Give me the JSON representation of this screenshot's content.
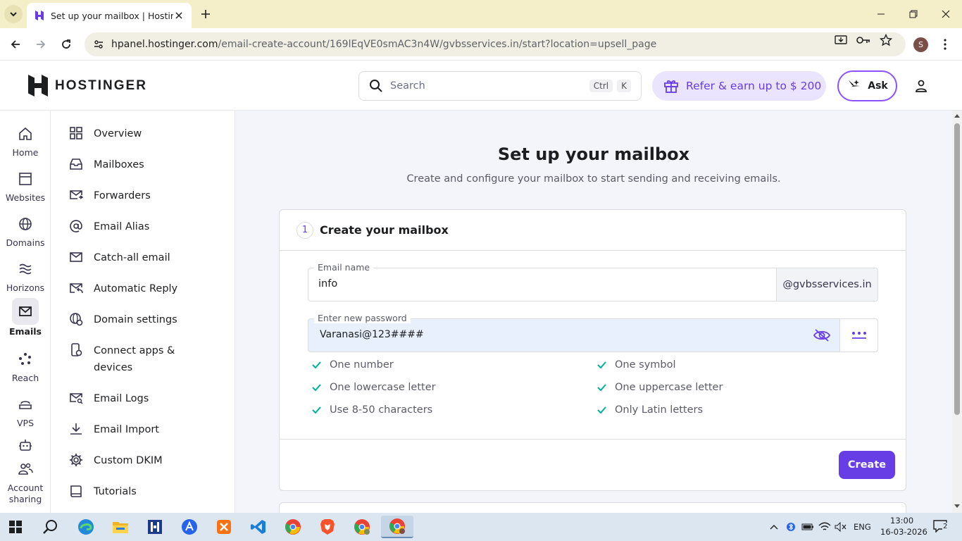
{
  "browser": {
    "tab_title": "Set up your mailbox | Hostinger",
    "url_host": "hpanel.hostinger.com",
    "url_path": "/email-create-account/169lEqVE0smAC3n4W/gvbsservices.in/start?location=upsell_page",
    "profile_initial": "S"
  },
  "header": {
    "logo_text": "HOSTINGER",
    "search_placeholder": "Search",
    "search_kbd_1": "Ctrl",
    "search_kbd_2": "K",
    "refer_label": "Refer & earn up to $ 200",
    "ask_label": "Ask"
  },
  "rail": {
    "items": [
      {
        "label": "Home",
        "icon": "home-icon"
      },
      {
        "label": "Websites",
        "icon": "browser-window-icon"
      },
      {
        "label": "Domains",
        "icon": "globe-icon"
      },
      {
        "label": "Horizons",
        "icon": "waves-icon"
      },
      {
        "label": "Emails",
        "icon": "envelope-icon"
      },
      {
        "label": "Reach",
        "icon": "reach-icon"
      },
      {
        "label": "VPS",
        "icon": "server-icon"
      },
      {
        "label": "",
        "icon": "robot-icon"
      },
      {
        "label": "Account sharing",
        "icon": "users-icon"
      }
    ]
  },
  "submenu": {
    "items": [
      {
        "label": "Overview",
        "icon": "grid-icon"
      },
      {
        "label": "Mailboxes",
        "icon": "inbox-icon"
      },
      {
        "label": "Forwarders",
        "icon": "mail-forward-icon"
      },
      {
        "label": "Email Alias",
        "icon": "at-icon"
      },
      {
        "label": "Catch-all email",
        "icon": "envelope-icon"
      },
      {
        "label": "Automatic Reply",
        "icon": "mail-reply-icon"
      },
      {
        "label": "Domain settings",
        "icon": "globe-gear-icon"
      },
      {
        "label": "Connect apps & devices",
        "icon": "device-icon"
      },
      {
        "label": "Email Logs",
        "icon": "mail-search-icon"
      },
      {
        "label": "Email Import",
        "icon": "download-icon"
      },
      {
        "label": "Custom DKIM",
        "icon": "gear-icon"
      },
      {
        "label": "Tutorials",
        "icon": "book-icon"
      }
    ]
  },
  "main": {
    "title": "Set up your mailbox",
    "subtitle": "Create and configure your mailbox to start sending and receiving emails.",
    "step_number": "1",
    "step_title": "Create your mailbox",
    "email_label": "Email name",
    "email_value": "info",
    "domain_suffix": "@gvbsservices.in",
    "password_label": "Enter new password",
    "password_value": "Varanasi@123####",
    "rules": [
      "One number",
      "One symbol",
      "One lowercase letter",
      "One uppercase letter",
      "Use 8-50 characters",
      "Only Latin letters"
    ],
    "create_label": "Create"
  },
  "taskbar": {
    "lang": "ENG",
    "time": "13:00",
    "date": "16-03-2026",
    "notifications": "2"
  },
  "colors": {
    "accent": "#673de6",
    "check": "#00b090"
  }
}
